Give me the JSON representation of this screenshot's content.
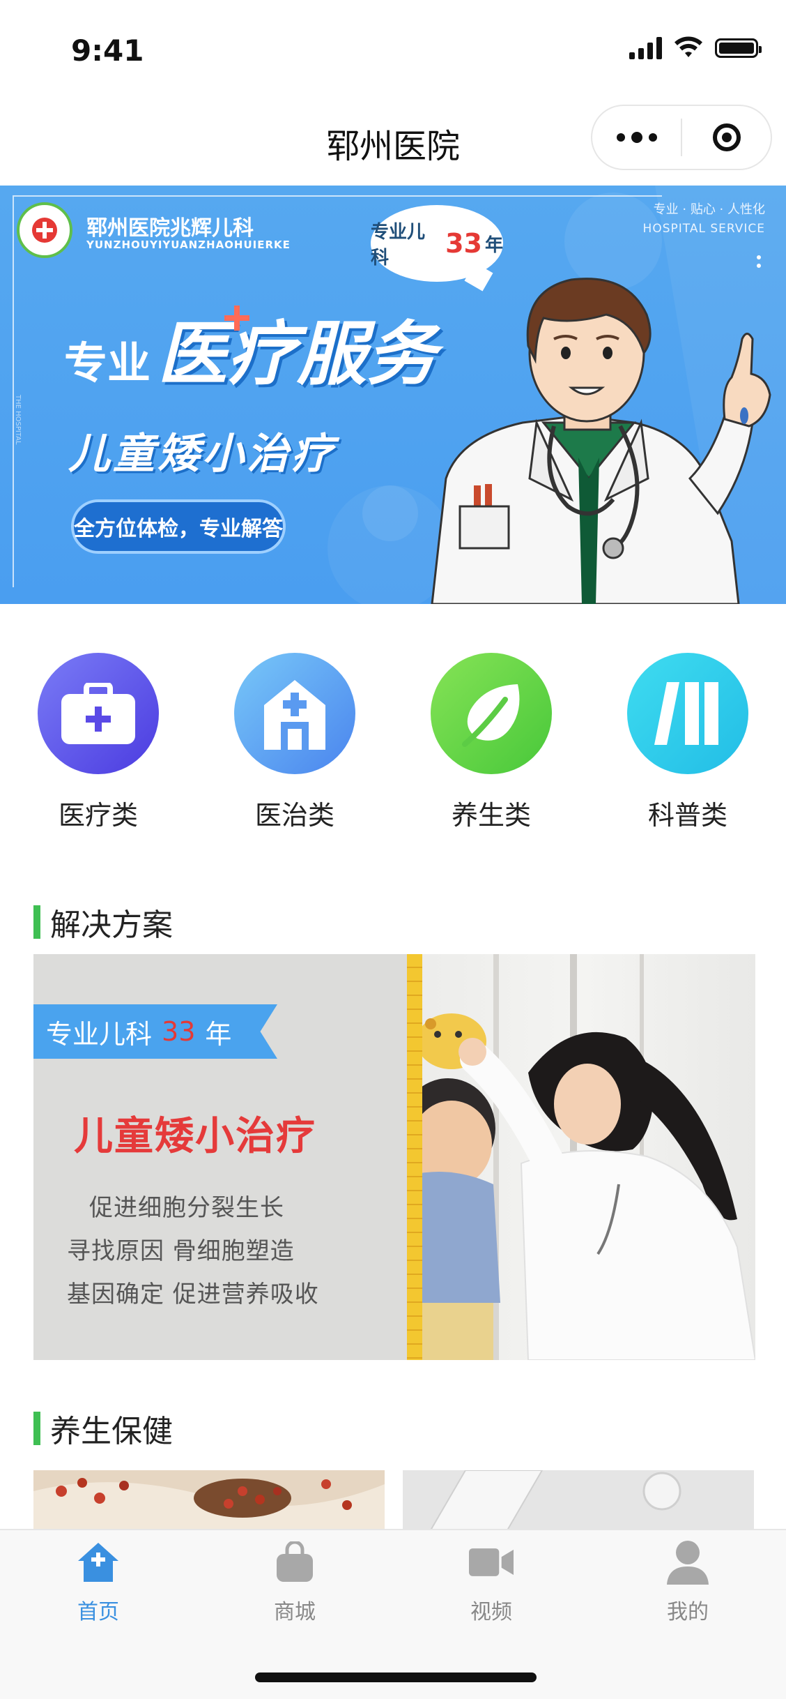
{
  "status_bar": {
    "time": "9:41"
  },
  "nav": {
    "title": "郓州医院"
  },
  "banner": {
    "hospital_name": "郓州医院兆辉儿科",
    "hospital_pinyin": "YUNZHOUYIYUANZHAOHUIERKE",
    "slogan_right": "专业 · 贴心 · 人性化",
    "service_right": "HOSPITAL SERVICE",
    "bubble_prefix": "专业儿科",
    "bubble_number": "33",
    "bubble_suffix": "年",
    "headline_small": "专业",
    "headline_big": "医疗服务",
    "subheadline": "儿童矮小治疗",
    "pill": "全方位体检，专业解答",
    "side_text": "THE HOSPITAL"
  },
  "categories": [
    {
      "label": "医疗类",
      "icon": "medical-kit-icon",
      "color_from": "#6f6ff4",
      "color_to": "#4d3fe3"
    },
    {
      "label": "医治类",
      "icon": "hospital-icon",
      "color_from": "#6ebdf7",
      "color_to": "#4e88ef"
    },
    {
      "label": "养生类",
      "icon": "leaf-icon",
      "color_from": "#7cde4f",
      "color_to": "#4fcc3d"
    },
    {
      "label": "科普类",
      "icon": "books-icon",
      "color_from": "#35d8ee",
      "color_to": "#23bfe6"
    }
  ],
  "sections": {
    "solution_title": "解决方案",
    "health_title": "养生保健"
  },
  "solution_card": {
    "ribbon_prefix": "专业儿科",
    "ribbon_number": "33",
    "ribbon_suffix": "年",
    "headline": "儿童矮小治疗",
    "points": [
      "促进细胞分裂生长",
      "寻找原因  骨细胞塑造",
      "基因确定  促进营养吸收"
    ]
  },
  "tab_bar": {
    "accent_color": "#3a90e0",
    "items": [
      {
        "label": "首页",
        "icon": "home-icon",
        "active": true
      },
      {
        "label": "商城",
        "icon": "shopping-bag-icon",
        "active": false
      },
      {
        "label": "视频",
        "icon": "video-camera-icon",
        "active": false
      },
      {
        "label": "我的",
        "icon": "user-icon",
        "active": false
      }
    ]
  }
}
